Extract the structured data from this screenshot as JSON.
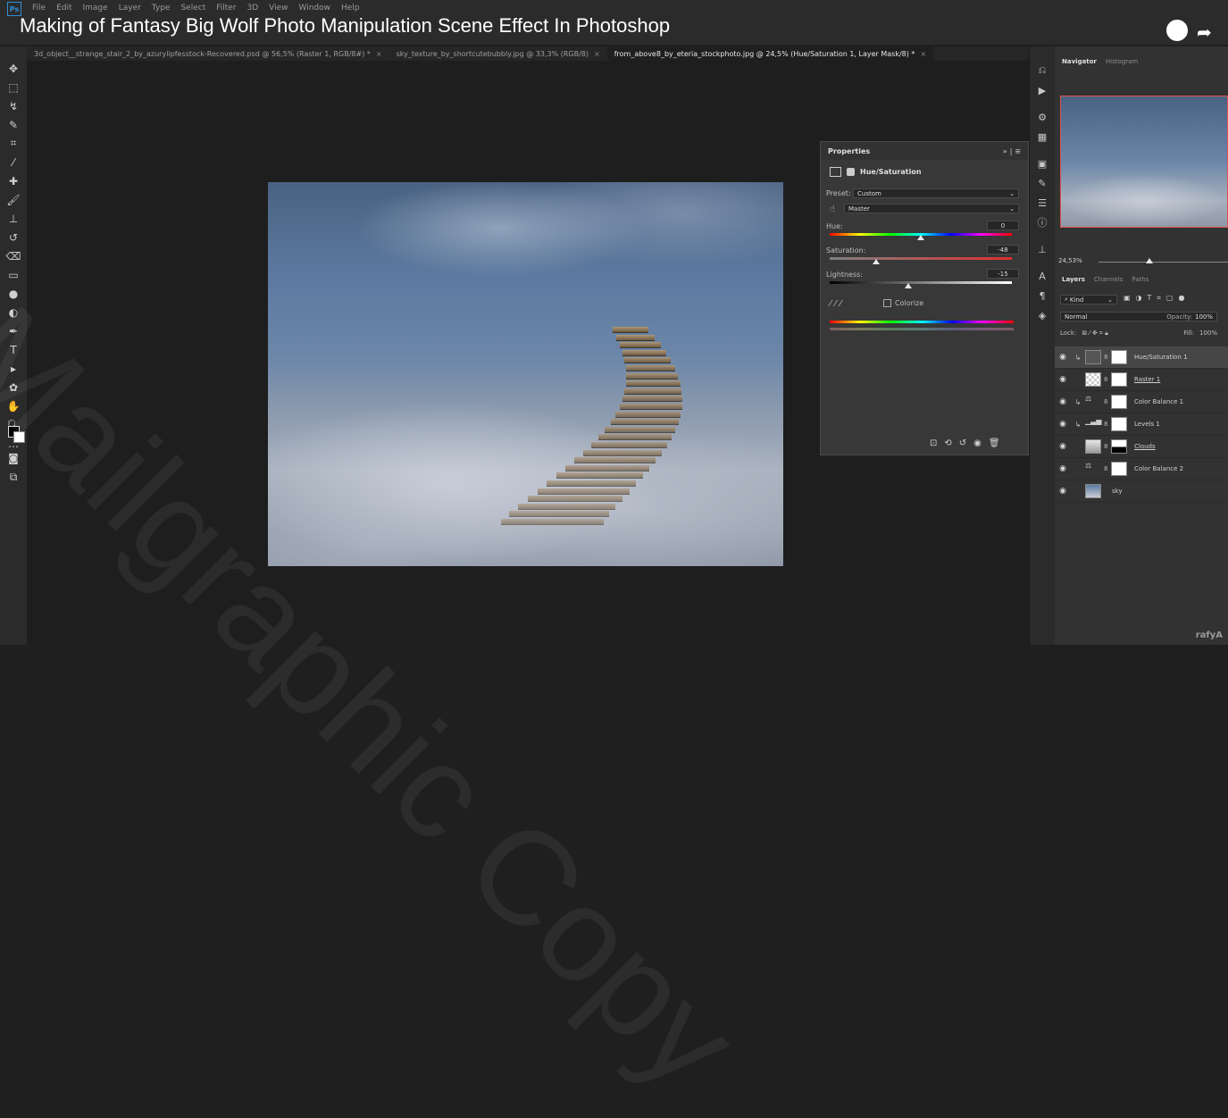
{
  "video_title": "Making of Fantasy Big Wolf Photo Manipulation Scene Effect In Photoshop",
  "menu": [
    "File",
    "Edit",
    "Image",
    "Layer",
    "Type",
    "Select",
    "Filter",
    "3D",
    "View",
    "Window",
    "Help"
  ],
  "app_logo": "Ps",
  "doc_tabs": [
    {
      "label": "3d_object__strange_stair_2_by_azurylipfesstock-Recovered.psd @ 56,5% (Raster 1, RGB/8#) *"
    },
    {
      "label": "sky_texture_by_shortcutebubbly.jpg @ 33,3% (RGB/8)"
    },
    {
      "label": "from_above8_by_eteria_stockphoto.jpg @ 24,5% (Hue/Saturation 1, Layer Mask/8) *"
    }
  ],
  "tab_close": "×",
  "properties": {
    "title": "Properties",
    "adjustment": "Hue/Saturation",
    "preset_label": "Preset:",
    "preset_value": "Custom",
    "channel": "Master",
    "hue_label": "Hue:",
    "hue_value": "0",
    "saturation_label": "Saturation:",
    "saturation_value": "-48",
    "lightness_label": "Lightness:",
    "lightness_value": "-15",
    "colorize_label": "Colorize"
  },
  "navigator": {
    "tabs": [
      "Navigator",
      "Histogram"
    ],
    "zoom": "24,53%"
  },
  "layers_panel": {
    "tabs": [
      "Layers",
      "Channels",
      "Paths"
    ],
    "filter_kind": "Kind",
    "blend_mode": "Normal",
    "opacity_label": "Opacity:",
    "opacity_value": "100%",
    "lock_label": "Lock:",
    "fill_label": "Fill:",
    "fill_value": "100%",
    "layers": [
      {
        "name": "Hue/Saturation 1",
        "selected": true
      },
      {
        "name": "Raster 1",
        "selected": false
      },
      {
        "name": "Color Balance 1",
        "selected": false
      },
      {
        "name": "Levels 1",
        "selected": false
      },
      {
        "name": "Clouds",
        "selected": false
      },
      {
        "name": "Color Balance 2",
        "selected": false
      },
      {
        "name": "sky",
        "selected": false
      }
    ]
  },
  "watermark": "Mailgraphic Copy",
  "corner_mark": "rafyA"
}
